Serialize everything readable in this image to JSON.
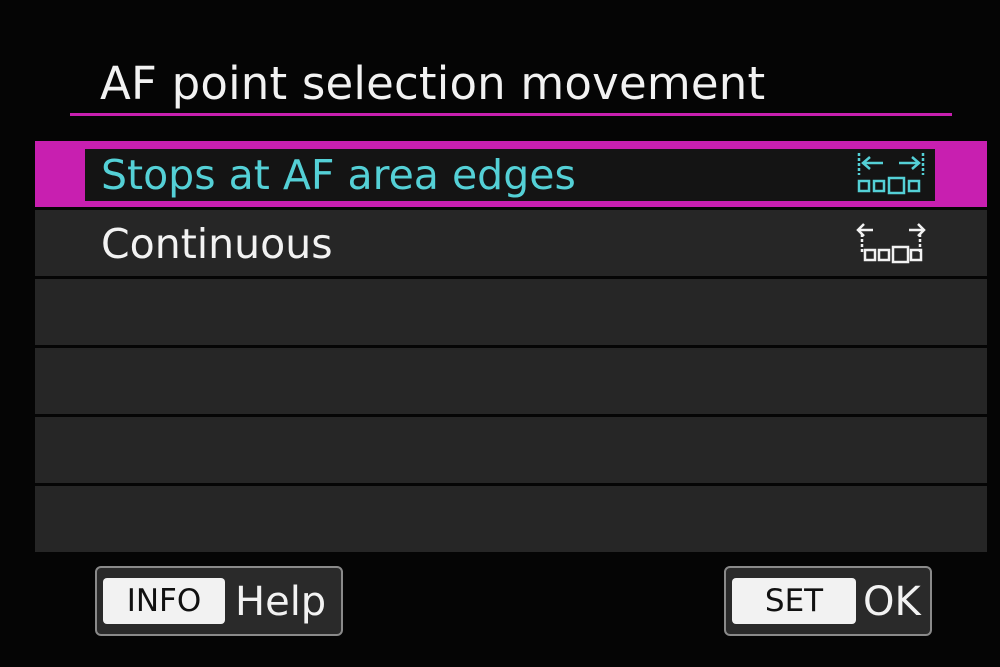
{
  "screen": {
    "title": "AF point selection movement"
  },
  "colors": {
    "accent": "#c81fb0",
    "selected_text": "#54d0d6",
    "text": "#f2f2f2"
  },
  "menu": {
    "options": [
      {
        "label": "Stops at AF area edges",
        "icon": "stops-at-edges-icon",
        "selected": true
      },
      {
        "label": "Continuous",
        "icon": "continuous-icon",
        "selected": false
      }
    ]
  },
  "footer": {
    "info": {
      "key": "INFO",
      "label": "Help"
    },
    "set": {
      "key": "SET",
      "label": "OK"
    }
  }
}
